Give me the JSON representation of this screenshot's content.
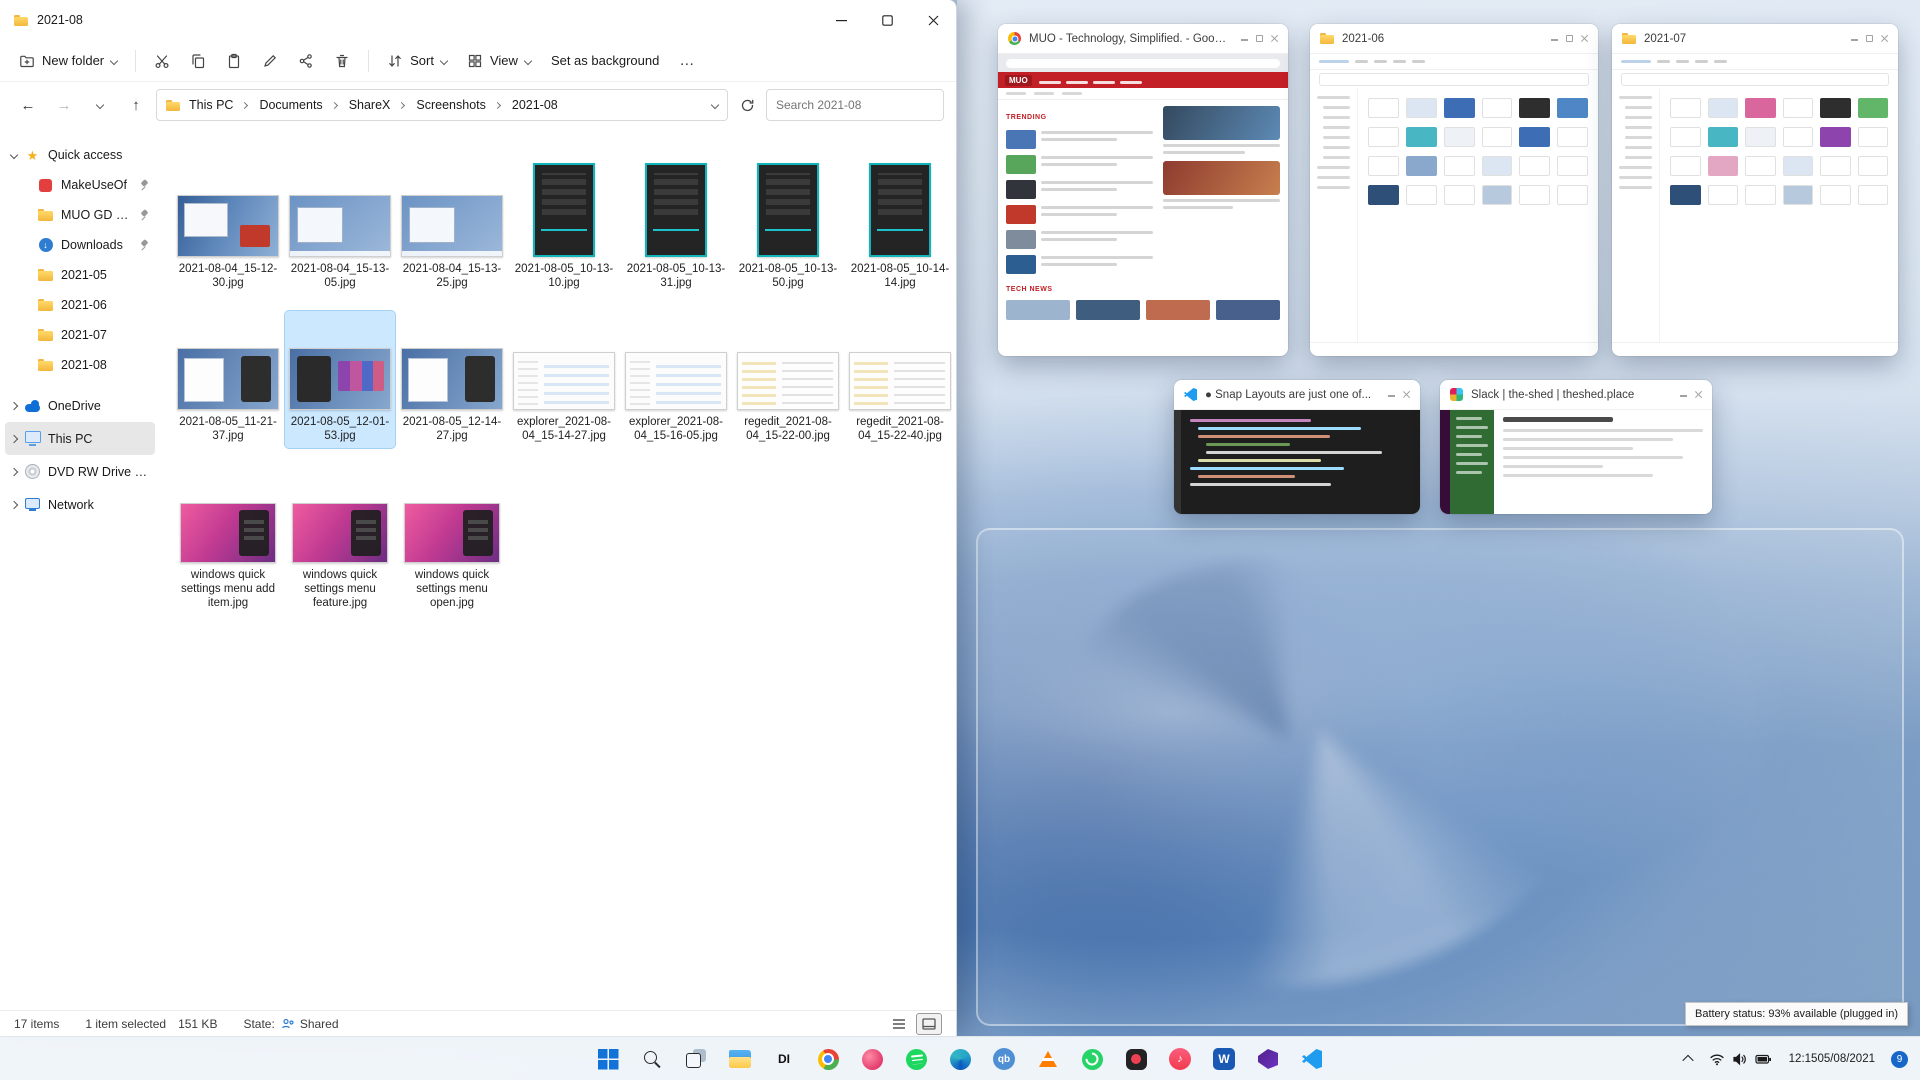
{
  "explorer": {
    "title": "2021-08",
    "toolbar": {
      "new_folder": "New folder",
      "sort": "Sort",
      "view": "View",
      "set_as_background": "Set as background",
      "more": "…"
    },
    "nav": {
      "breadcrumb": [
        "This PC",
        "Documents",
        "ShareX",
        "Screenshots",
        "2021-08"
      ],
      "search_placeholder": "Search 2021-08"
    },
    "sidebar": {
      "quick_label": "Quick access",
      "quick_items": [
        {
          "label": "MakeUseOf",
          "icon": "makeuseof",
          "pinned": true
        },
        {
          "label": "MUO GD Screen",
          "icon": "folder",
          "pinned": true
        },
        {
          "label": "Downloads",
          "icon": "downloads",
          "pinned": true
        },
        {
          "label": "2021-05",
          "icon": "folder"
        },
        {
          "label": "2021-06",
          "icon": "folder"
        },
        {
          "label": "2021-07",
          "icon": "folder"
        },
        {
          "label": "2021-08",
          "icon": "folder"
        }
      ],
      "roots": [
        {
          "label": "OneDrive",
          "icon": "onedrive"
        },
        {
          "label": "This PC",
          "icon": "pc",
          "selected": true
        },
        {
          "label": "DVD RW Drive (D:) A",
          "icon": "disc"
        },
        {
          "label": "Network",
          "icon": "network"
        }
      ]
    },
    "files": [
      {
        "name": "2021-08-04_15-12-30.jpg",
        "thumb": "photo"
      },
      {
        "name": "2021-08-04_15-13-05.jpg",
        "thumb": "desktop"
      },
      {
        "name": "2021-08-04_15-13-25.jpg",
        "thumb": "desktop"
      },
      {
        "name": "2021-08-05_10-13-10.jpg",
        "thumb": "qs-dark"
      },
      {
        "name": "2021-08-05_10-13-31.jpg",
        "thumb": "qs-dark"
      },
      {
        "name": "2021-08-05_10-13-50.jpg",
        "thumb": "qs-dark"
      },
      {
        "name": "2021-08-05_10-14-14.jpg",
        "thumb": "qs-dark"
      },
      {
        "name": "2021-08-05_11-21-37.jpg",
        "thumb": "desktop-panel"
      },
      {
        "name": "2021-08-05_12-01-53.jpg",
        "thumb": "tiles",
        "selected": true
      },
      {
        "name": "2021-08-05_12-14-27.jpg",
        "thumb": "desktop-panel"
      },
      {
        "name": "explorer_2021-08-04_15-14-27.jpg",
        "thumb": "explorer"
      },
      {
        "name": "explorer_2021-08-04_15-16-05.jpg",
        "thumb": "explorer"
      },
      {
        "name": "regedit_2021-08-04_15-22-00.jpg",
        "thumb": "regedit"
      },
      {
        "name": "regedit_2021-08-04_15-22-40.jpg",
        "thumb": "regedit"
      },
      {
        "name": "windows quick settings menu add item.jpg",
        "thumb": "pink"
      },
      {
        "name": "windows quick settings menu feature.jpg",
        "thumb": "pink"
      },
      {
        "name": "windows quick settings menu open.jpg",
        "thumb": "pink"
      }
    ],
    "status": {
      "count": "17 items",
      "selected": "1 item selected",
      "size": "151 KB",
      "state_label": "State:",
      "state_value": "Shared"
    }
  },
  "snap_assist": {
    "previews": [
      {
        "title": "MUO - Technology, Simplified. - Goog...",
        "app": "chrome",
        "logo": "MUO",
        "sections": [
          "TRENDING",
          "TECH NEWS"
        ]
      },
      {
        "title": "2021-06",
        "app": "explorer"
      },
      {
        "title": "2021-07",
        "app": "explorer"
      },
      {
        "title": "● Snap Layouts are just one of...",
        "app": "vscode"
      },
      {
        "title": "Slack | the-shed | theshed.place",
        "app": "slack"
      }
    ]
  },
  "taskbar": {
    "apps": [
      {
        "app": "start"
      },
      {
        "app": "search"
      },
      {
        "app": "task-view"
      },
      {
        "app": "file-explorer"
      },
      {
        "app": "di",
        "glyph": "DI"
      },
      {
        "app": "chrome"
      },
      {
        "app": "paint"
      },
      {
        "app": "spotify"
      },
      {
        "app": "edge"
      },
      {
        "app": "qbittorrent",
        "glyph": "qb"
      },
      {
        "app": "vlc"
      },
      {
        "app": "whatsapp"
      },
      {
        "app": "pocket"
      },
      {
        "app": "itunes",
        "glyph": "♪"
      },
      {
        "app": "word",
        "glyph": "W"
      },
      {
        "app": "visual-studio"
      },
      {
        "app": "vscode"
      }
    ],
    "tray": {
      "time": "12:15",
      "date": "05/08/2021",
      "badge": "9"
    },
    "tooltip": "Battery status: 93% available (plugged in)"
  }
}
